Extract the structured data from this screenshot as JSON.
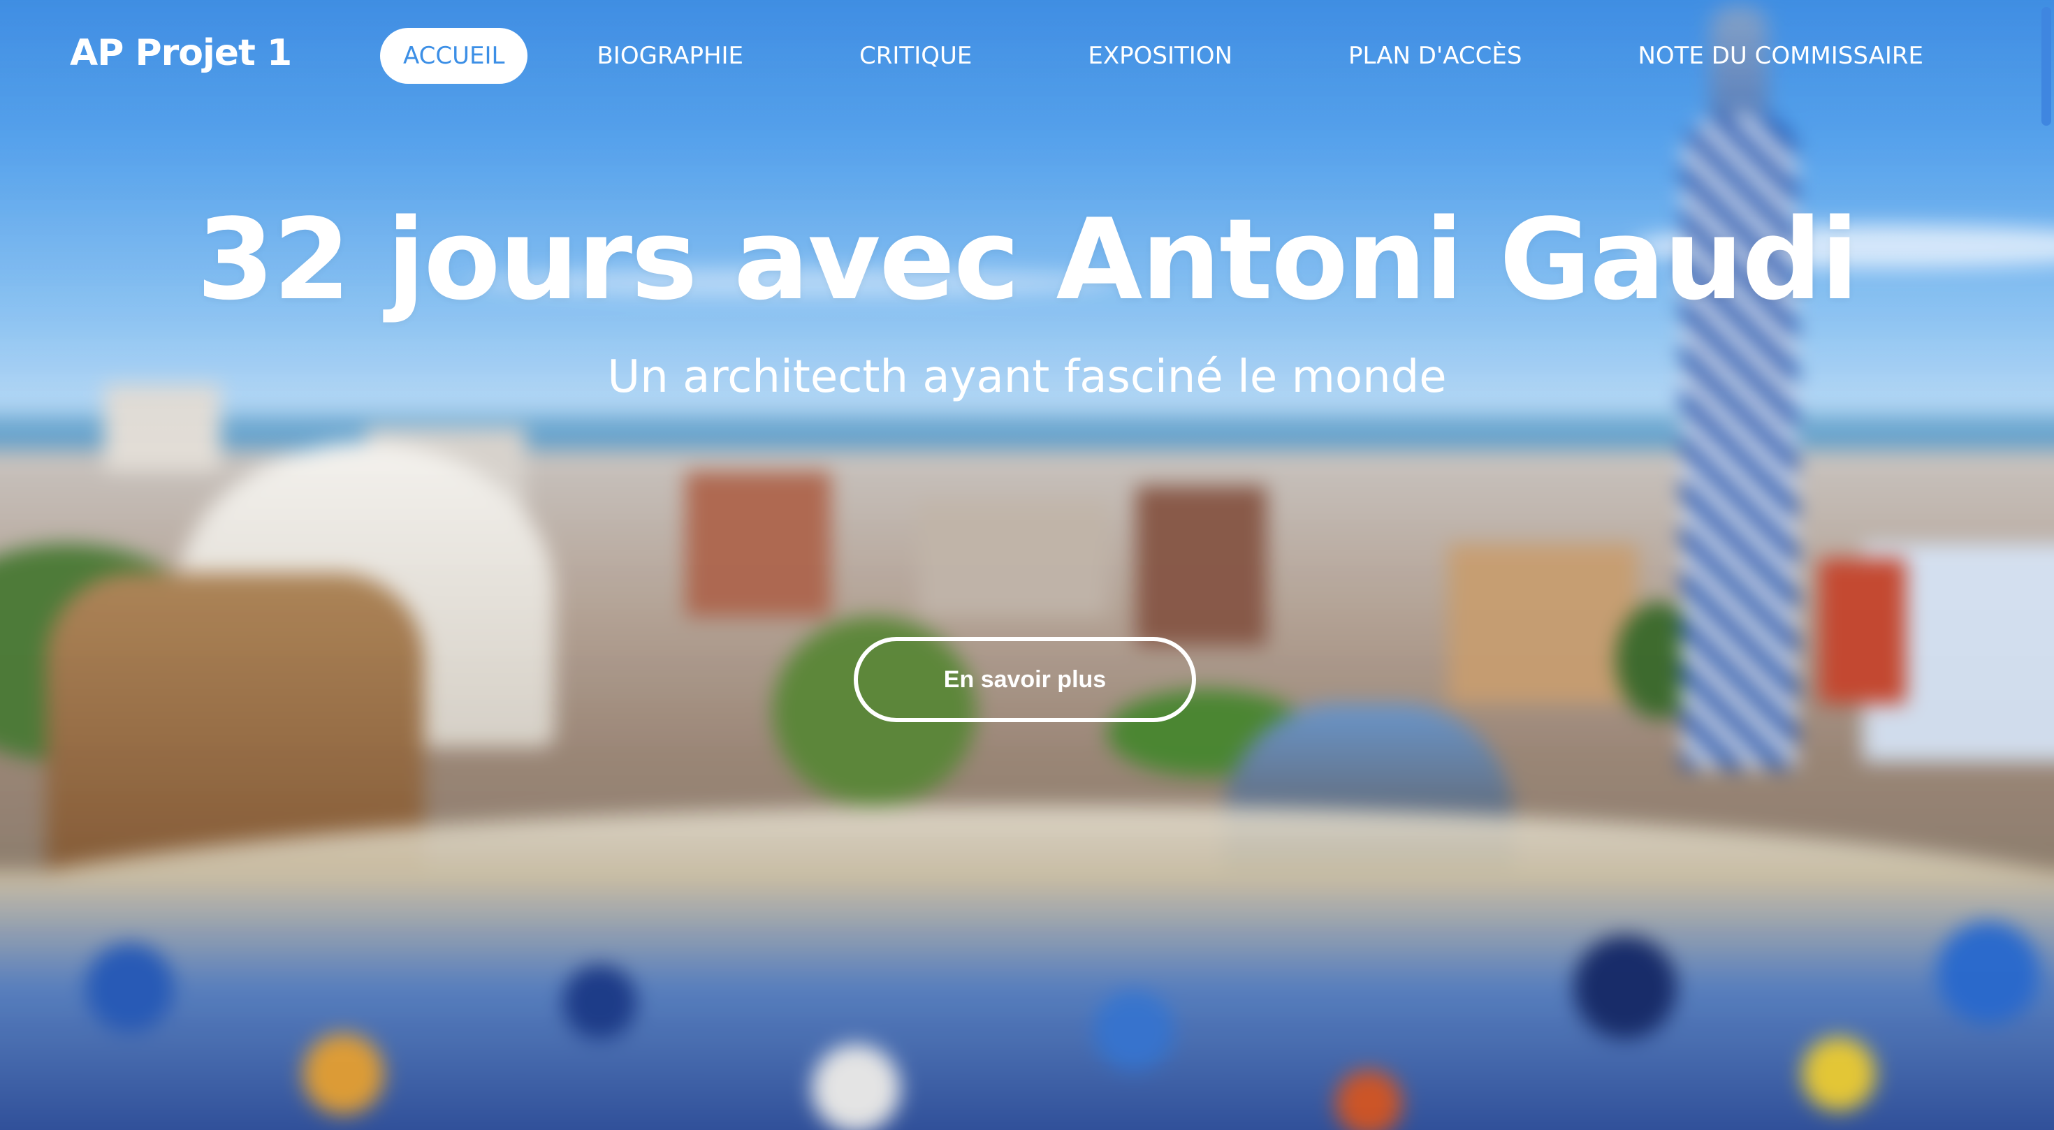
{
  "header": {
    "brand": "AP Projet 1",
    "nav": [
      {
        "label": "ACCUEIL",
        "active": true
      },
      {
        "label": "BIOGRAPHIE",
        "active": false
      },
      {
        "label": "CRITIQUE",
        "active": false
      },
      {
        "label": "EXPOSITION",
        "active": false
      },
      {
        "label": "PLAN D'ACCÈS",
        "active": false
      },
      {
        "label": "NOTE DU COMMISSAIRE",
        "active": false
      }
    ]
  },
  "hero": {
    "title": "32 jours avec Antoni Gaudi",
    "subtitle": "Un architecth ayant fasciné le monde",
    "cta_label": "En savoir plus"
  },
  "colors": {
    "accent": "#3c8fe6",
    "text_on_image": "#ffffff",
    "scrollbar": "#3f86e0"
  }
}
